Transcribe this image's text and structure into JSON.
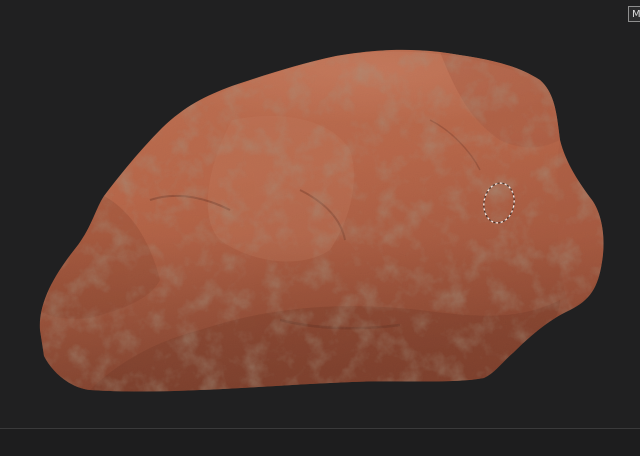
{
  "viewport": {
    "corner_button_label": "M",
    "background_color": "#202021",
    "model": {
      "subject": "rock",
      "base_color": "#b8674a",
      "highlight_color": "#d08a6b",
      "shadow_color": "#6b3324",
      "moss_color": "#5c6e5a"
    },
    "brush_cursor": {
      "shape": "dashed-circle"
    }
  },
  "bottom_bar": {
    "background_color": "#1d1d1e"
  }
}
